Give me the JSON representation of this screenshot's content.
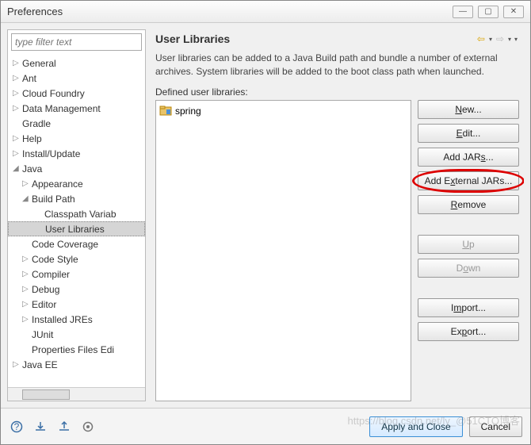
{
  "window": {
    "title": "Preferences"
  },
  "filter": {
    "placeholder": "type filter text"
  },
  "tree": {
    "items": [
      {
        "label": "General",
        "lvl": 0,
        "arrow": "▷"
      },
      {
        "label": "Ant",
        "lvl": 0,
        "arrow": "▷"
      },
      {
        "label": "Cloud Foundry",
        "lvl": 0,
        "arrow": "▷"
      },
      {
        "label": "Data Management",
        "lvl": 0,
        "arrow": "▷"
      },
      {
        "label": "Gradle",
        "lvl": 0,
        "arrow": ""
      },
      {
        "label": "Help",
        "lvl": 0,
        "arrow": "▷"
      },
      {
        "label": "Install/Update",
        "lvl": 0,
        "arrow": "▷"
      },
      {
        "label": "Java",
        "lvl": 0,
        "arrow": "◢"
      },
      {
        "label": "Appearance",
        "lvl": 1,
        "arrow": "▷"
      },
      {
        "label": "Build Path",
        "lvl": 1,
        "arrow": "◢"
      },
      {
        "label": "Classpath Variab",
        "lvl": 2,
        "arrow": ""
      },
      {
        "label": "User Libraries",
        "lvl": 2,
        "arrow": "",
        "selected": true
      },
      {
        "label": "Code Coverage",
        "lvl": 1,
        "arrow": ""
      },
      {
        "label": "Code Style",
        "lvl": 1,
        "arrow": "▷"
      },
      {
        "label": "Compiler",
        "lvl": 1,
        "arrow": "▷"
      },
      {
        "label": "Debug",
        "lvl": 1,
        "arrow": "▷"
      },
      {
        "label": "Editor",
        "lvl": 1,
        "arrow": "▷"
      },
      {
        "label": "Installed JREs",
        "lvl": 1,
        "arrow": "▷"
      },
      {
        "label": "JUnit",
        "lvl": 1,
        "arrow": ""
      },
      {
        "label": "Properties Files Edi",
        "lvl": 1,
        "arrow": ""
      },
      {
        "label": "Java EE",
        "lvl": 0,
        "arrow": "▷"
      }
    ]
  },
  "page": {
    "heading": "User Libraries",
    "description": "User libraries can be added to a Java Build path and bundle a number of external archives. System libraries will be added to the boot class path when launched.",
    "defined_label": "Defined user libraries:",
    "library_name": "spring"
  },
  "buttons": {
    "new": "New...",
    "edit": "Edit...",
    "add_jars": "Add JARs...",
    "add_ext": "Add External JARs...",
    "remove": "Remove",
    "up": "Up",
    "down": "Down",
    "import": "Import...",
    "export": "Export..."
  },
  "footer": {
    "apply": "Apply and Close",
    "cancel": "Cancel"
  },
  "watermark": "https://blog.csdn.net/ly_@51CTO博客"
}
